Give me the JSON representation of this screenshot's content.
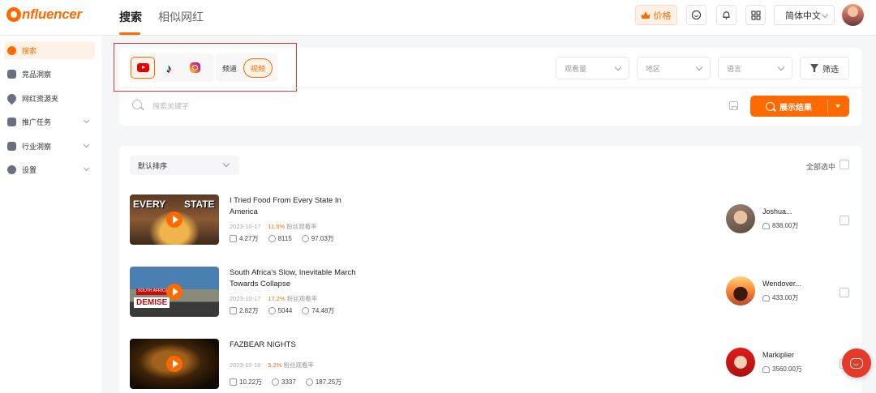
{
  "app": {
    "logo_text": "nfluencer"
  },
  "top_tabs": [
    {
      "label": "搜索",
      "active": true
    },
    {
      "label": "相似网红",
      "active": false
    }
  ],
  "header": {
    "price_label": "价格",
    "language": "简体中文"
  },
  "sidebar": {
    "items": [
      {
        "label": "搜索",
        "icon": "search-circle-icon",
        "active": true
      },
      {
        "label": "竞品洞察",
        "icon": "r-badge-icon"
      },
      {
        "label": "网红资源夹",
        "icon": "heart-icon"
      },
      {
        "label": "推广任务",
        "icon": "clipboard-icon",
        "expandable": true
      },
      {
        "label": "行业洞察",
        "icon": "chart-icon",
        "expandable": true
      },
      {
        "label": "设置",
        "icon": "gear-icon",
        "expandable": true
      }
    ]
  },
  "filters": {
    "platforms": [
      "youtube",
      "tiktok",
      "instagram"
    ],
    "active_platform": "youtube",
    "content_types": [
      "频道",
      "视频"
    ],
    "active_type": "视频",
    "views_placeholder": "观看量",
    "region_placeholder": "地区",
    "language_placeholder": "语言",
    "filter_label": "筛选",
    "search_placeholder": "搜索关键字",
    "show_results_label": "展示结果"
  },
  "results": {
    "sort_label": "默认排序",
    "select_all_label": "全部选中",
    "metric_label": "粉丝观看率",
    "thumb1_text": [
      "EVERY",
      "STATE"
    ],
    "thumb2_text": {
      "tag": "SOUTH AFRICA'S",
      "word": "DEMISE"
    },
    "videos": [
      {
        "title": "I Tried Food From Every State In America",
        "date": "2023-10-17",
        "rate": "11.5%",
        "likes": "4.27万",
        "comments": "8115",
        "views": "97.03万",
        "creator": "Joshua...",
        "followers": "838.00万"
      },
      {
        "title": "South Africa's Slow, Inevitable March Towards Collapse",
        "date": "2023-10-17",
        "rate": "17.2%",
        "likes": "2.82万",
        "comments": "5044",
        "views": "74.48万",
        "creator": "Wendover...",
        "followers": "433.00万"
      },
      {
        "title": "FAZBEAR NIGHTS",
        "date": "2023-10-16",
        "rate": "5.2%",
        "likes": "10.22万",
        "comments": "3337",
        "views": "187.25万",
        "creator": "Markiplier",
        "followers": "3560.00万"
      }
    ]
  },
  "colors": {
    "accent": "#ff6a00",
    "highlight_box": "#e53935",
    "chat_fab": "#e53a2a"
  }
}
